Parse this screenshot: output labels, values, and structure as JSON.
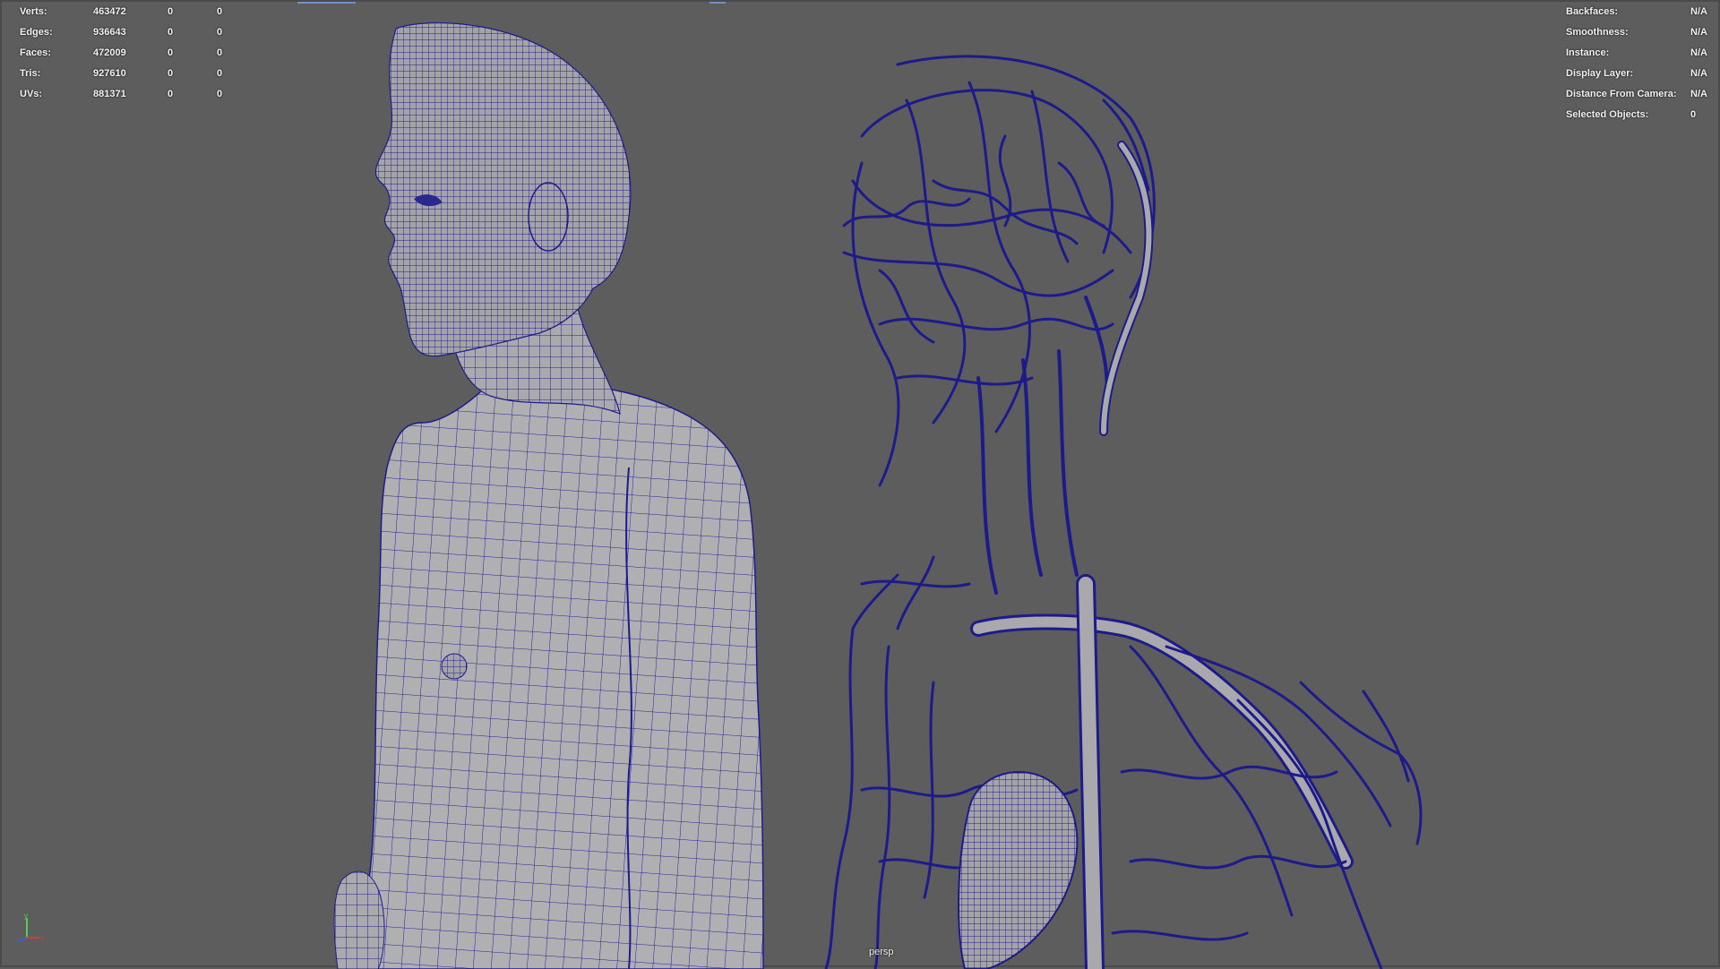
{
  "stats_left": {
    "rows": [
      {
        "label": "Verts:",
        "total": "463472",
        "selected": "0",
        "component": "0"
      },
      {
        "label": "Edges:",
        "total": "936643",
        "selected": "0",
        "component": "0"
      },
      {
        "label": "Faces:",
        "total": "472009",
        "selected": "0",
        "component": "0"
      },
      {
        "label": "Tris:",
        "total": "927610",
        "selected": "0",
        "component": "0"
      },
      {
        "label": "UVs:",
        "total": "881371",
        "selected": "0",
        "component": "0"
      }
    ]
  },
  "stats_right": {
    "rows": [
      {
        "label": "Backfaces:",
        "value": "N/A"
      },
      {
        "label": "Smoothness:",
        "value": "N/A"
      },
      {
        "label": "Instance:",
        "value": "N/A"
      },
      {
        "label": "Display Layer:",
        "value": "N/A"
      },
      {
        "label": "Distance From Camera:",
        "value": "N/A"
      },
      {
        "label": "Selected Objects:",
        "value": "0"
      }
    ]
  },
  "camera": {
    "name": "persp"
  },
  "axis_gizmo": {
    "x_color": "#d63a3a",
    "y_color": "#4fd04f",
    "z_color": "#3a5fd6"
  },
  "colors": {
    "viewport_bg": "#5d5d5d",
    "wire": "#1d1b8a",
    "mesh_fill": "#a9a9ad",
    "hud_text": "#f2f2f2"
  }
}
